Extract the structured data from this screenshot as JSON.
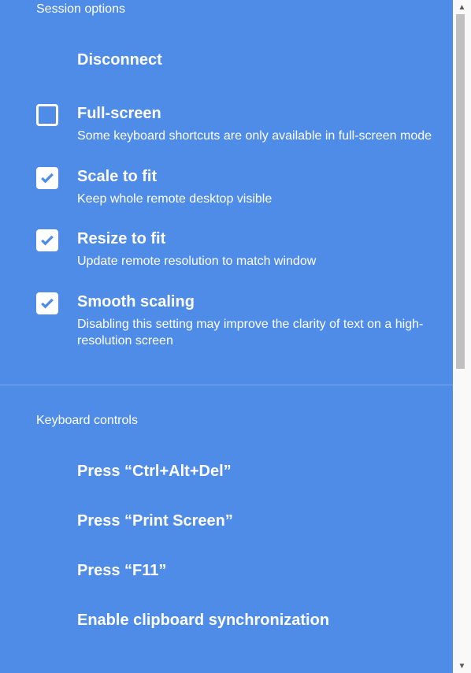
{
  "session_options": {
    "header": "Session options",
    "disconnect": "Disconnect",
    "fullscreen": {
      "title": "Full-screen",
      "desc": "Some keyboard shortcuts are only available in full-screen mode",
      "checked": false
    },
    "scale": {
      "title": "Scale to fit",
      "desc": "Keep whole remote desktop visible",
      "checked": true
    },
    "resize": {
      "title": "Resize to fit",
      "desc": "Update remote resolution to match window",
      "checked": true
    },
    "smooth": {
      "title": "Smooth scaling",
      "desc": "Disabling this setting may improve the clarity of text on a high-resolution screen",
      "checked": true
    }
  },
  "keyboard_controls": {
    "header": "Keyboard controls",
    "ctrl_alt_del": "Press “Ctrl+Alt+Del”",
    "print_screen": "Press “Print Screen”",
    "f11": "Press “F11”",
    "clipboard": "Enable clipboard synchronization"
  }
}
